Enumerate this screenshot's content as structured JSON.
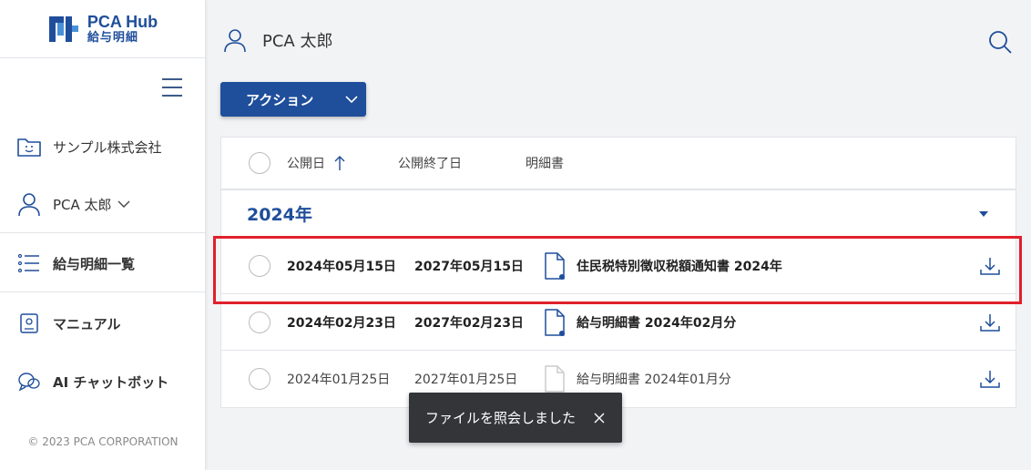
{
  "app": {
    "logo_title": "PCA Hub",
    "logo_subtitle": "給与明細",
    "copyright": "© 2023 PCA CORPORATION"
  },
  "sidebar": {
    "company": "サンプル株式会社",
    "user": "PCA 太郎",
    "nav": [
      {
        "label": "給与明細一覧",
        "icon": "list-icon"
      },
      {
        "label": "マニュアル",
        "icon": "manual-icon"
      },
      {
        "label": "AI チャットボット",
        "icon": "chatbot-icon"
      }
    ]
  },
  "header": {
    "user": "PCA 太郎"
  },
  "toolbar": {
    "action_label": "アクション"
  },
  "table": {
    "columns": [
      "公開日",
      "公開終了日",
      "明細書"
    ],
    "group": "2024年",
    "rows": [
      {
        "pub": "2024年05月15日",
        "end": "2027年05月15日",
        "doc": "住民税特別徴収税額通知書 2024年",
        "unread": true
      },
      {
        "pub": "2024年02月23日",
        "end": "2027年02月23日",
        "doc": "給与明細書 2024年02月分",
        "unread": true
      },
      {
        "pub": "2024年01月25日",
        "end": "2027年01月25日",
        "doc": "給与明細書 2024年01月分",
        "unread": false
      }
    ]
  },
  "toast": {
    "message": "ファイルを照会しました"
  },
  "colors": {
    "brand": "#1f4e9b",
    "highlight": "#e0202b",
    "toast_bg": "#333538"
  }
}
